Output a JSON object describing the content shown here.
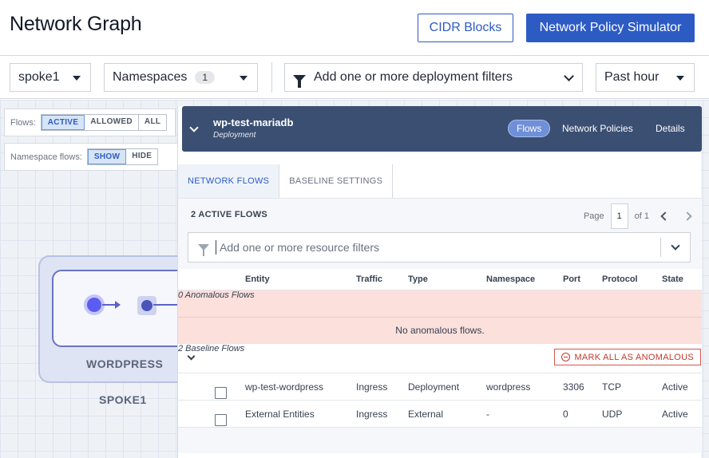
{
  "header": {
    "title": "Network Graph",
    "cidr_button": "CIDR Blocks",
    "simulator_button": "Network Policy Simulator"
  },
  "filters": {
    "cluster": "spoke1",
    "namespaces_label": "Namespaces",
    "namespaces_count": "1",
    "deployment_filter_placeholder": "Add one or more deployment filters",
    "time_range": "Past hour"
  },
  "graph": {
    "flows_label": "Flows:",
    "flows_options": [
      "ACTIVE",
      "ALLOWED",
      "ALL"
    ],
    "flows_selected": "ACTIVE",
    "namespace_flows_label": "Namespace flows:",
    "namespace_flows_options": [
      "SHOW",
      "HIDE"
    ],
    "namespace_flows_selected": "SHOW",
    "deployment_label": "WORDPRESS",
    "namespace_label": "SPOKE1"
  },
  "panel": {
    "entity_name": "wp-test-mariadb",
    "entity_type": "Deployment",
    "header_tabs": [
      "Flows",
      "Network Policies",
      "Details"
    ],
    "header_tab_selected": "Flows",
    "tabs": [
      "NETWORK FLOWS",
      "BASELINE SETTINGS"
    ],
    "tab_selected": "NETWORK FLOWS",
    "active_flows": "2 ACTIVE FLOWS",
    "pager": {
      "page_label": "Page",
      "page": "1",
      "of_label": "of 1"
    },
    "resource_filter_placeholder": "Add one or more resource filters",
    "columns": [
      "Entity",
      "Traffic",
      "Type",
      "Namespace",
      "Port",
      "Protocol",
      "State"
    ],
    "anomalous_header": "0 Anomalous Flows",
    "anomalous_empty": "No anomalous flows.",
    "baseline_header": "2 Baseline Flows",
    "mark_all_button": "MARK ALL AS ANOMALOUS",
    "rows": [
      {
        "entity": "wp-test-wordpress",
        "traffic": "Ingress",
        "type": "Deployment",
        "namespace": "wordpress",
        "port": "3306",
        "protocol": "TCP",
        "state": "Active"
      },
      {
        "entity": "External Entities",
        "traffic": "Ingress",
        "type": "External",
        "namespace": "-",
        "port": "0",
        "protocol": "UDP",
        "state": "Active"
      }
    ]
  },
  "colors": {
    "primary": "#2d5bc4",
    "panel_header": "#3b4f72",
    "anomalous_bg": "#fbe0dc",
    "danger": "#c0392b"
  }
}
